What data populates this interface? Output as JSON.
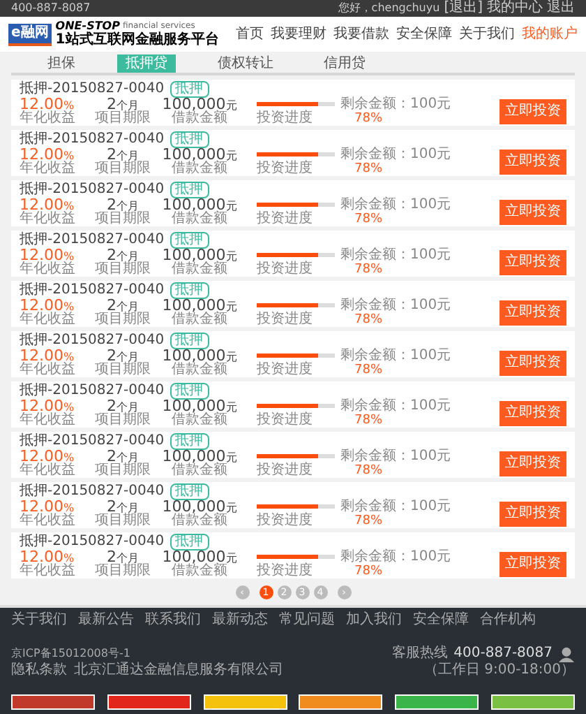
{
  "top_bar": {
    "phone": "400-887-8087",
    "links": [
      "您好，chengchuyu",
      "[退出]",
      "我的中心",
      "退出"
    ]
  },
  "header": {
    "logo": "e融网",
    "slogan_title": "ONE-STOP",
    "slogan_sub": "financial services",
    "slogan_cn": "1站式互联网金融服务平台",
    "nav": [
      {
        "label": "首页",
        "selected": false
      },
      {
        "label": "我要理财",
        "selected": false
      },
      {
        "label": "我要借款",
        "selected": false
      },
      {
        "label": "安全保障",
        "selected": false
      },
      {
        "label": "关于我们",
        "selected": false
      },
      {
        "label": "我的账户",
        "selected": true
      }
    ]
  },
  "tabs": [
    {
      "label": "担保",
      "selected": false
    },
    {
      "label": "抵押贷",
      "selected": true
    },
    {
      "label": "债权转让",
      "selected": false
    },
    {
      "label": "信用贷",
      "selected": false
    }
  ],
  "loans": [
    {
      "title": "抵押-20150827-0040",
      "tag": "抵押",
      "rate": "12.00",
      "rate_unit": "%",
      "rate_label": "年化收益",
      "term": "2",
      "term_unit": "个月",
      "term_label": "项目期限",
      "amount": "100,000",
      "amount_unit": "元",
      "amount_label": "借款金额",
      "progress_label": "投资进度",
      "level": 0.78,
      "percent": "78%",
      "remaining": "剩余金额：100元",
      "button": "立即投资"
    },
    {
      "title": "抵押-20150827-0040",
      "tag": "抵押",
      "rate": "12.00",
      "rate_unit": "%",
      "rate_label": "年化收益",
      "term": "2",
      "term_unit": "个月",
      "term_label": "项目期限",
      "amount": "100,000",
      "amount_unit": "元",
      "amount_label": "借款金额",
      "progress_label": "投资进度",
      "level": 0.78,
      "percent": "78%",
      "remaining": "剩余金额：100元",
      "button": "立即投资"
    },
    {
      "title": "抵押-20150827-0040",
      "tag": "抵押",
      "rate": "12.00",
      "rate_unit": "%",
      "rate_label": "年化收益",
      "term": "2",
      "term_unit": "个月",
      "term_label": "项目期限",
      "amount": "100,000",
      "amount_unit": "元",
      "amount_label": "借款金额",
      "progress_label": "投资进度",
      "level": 0.78,
      "percent": "78%",
      "remaining": "剩余金额：100元",
      "button": "立即投资"
    },
    {
      "title": "抵押-20150827-0040",
      "tag": "抵押",
      "rate": "12.00",
      "rate_unit": "%",
      "rate_label": "年化收益",
      "term": "2",
      "term_unit": "个月",
      "term_label": "项目期限",
      "amount": "100,000",
      "amount_unit": "元",
      "amount_label": "借款金额",
      "progress_label": "投资进度",
      "level": 0.78,
      "percent": "78%",
      "remaining": "剩余金额：100元",
      "button": "立即投资"
    },
    {
      "title": "抵押-20150827-0040",
      "tag": "抵押",
      "rate": "12.00",
      "rate_unit": "%",
      "rate_label": "年化收益",
      "term": "2",
      "term_unit": "个月",
      "term_label": "项目期限",
      "amount": "100,000",
      "amount_unit": "元",
      "amount_label": "借款金额",
      "progress_label": "投资进度",
      "level": 0.78,
      "percent": "78%",
      "remaining": "剩余金额：100元",
      "button": "立即投资"
    },
    {
      "title": "抵押-20150827-0040",
      "tag": "抵押",
      "rate": "12.00",
      "rate_unit": "%",
      "rate_label": "年化收益",
      "term": "2",
      "term_unit": "个月",
      "term_label": "项目期限",
      "amount": "100,000",
      "amount_unit": "元",
      "amount_label": "借款金额",
      "progress_label": "投资进度",
      "level": 0.78,
      "percent": "78%",
      "remaining": "剩余金额：100元",
      "button": "立即投资"
    },
    {
      "title": "抵押-20150827-0040",
      "tag": "抵押",
      "rate": "12.00",
      "rate_unit": "%",
      "rate_label": "年化收益",
      "term": "2",
      "term_unit": "个月",
      "term_label": "项目期限",
      "amount": "100,000",
      "amount_unit": "元",
      "amount_label": "借款金额",
      "progress_label": "投资进度",
      "level": 0.78,
      "percent": "78%",
      "remaining": "剩余金额：100元",
      "button": "立即投资"
    },
    {
      "title": "抵押-20150827-0040",
      "tag": "抵押",
      "rate": "12.00",
      "rate_unit": "%",
      "rate_label": "年化收益",
      "term": "2",
      "term_unit": "个月",
      "term_label": "项目期限",
      "amount": "100,000",
      "amount_unit": "元",
      "amount_label": "借款金额",
      "progress_label": "投资进度",
      "level": 0.78,
      "percent": "78%",
      "remaining": "剩余金额：100元",
      "button": "立即投资"
    },
    {
      "title": "抵押-20150827-0040",
      "tag": "抵押",
      "rate": "12.00",
      "rate_unit": "%",
      "rate_label": "年化收益",
      "term": "2",
      "term_unit": "个月",
      "term_label": "项目期限",
      "amount": "100,000",
      "amount_unit": "元",
      "amount_label": "借款金额",
      "progress_label": "投资进度",
      "level": 0.78,
      "percent": "78%",
      "remaining": "剩余金额：100元",
      "button": "立即投资"
    },
    {
      "title": "抵押-20150827-0040",
      "tag": "抵押",
      "rate": "12.00",
      "rate_unit": "%",
      "rate_label": "年化收益",
      "term": "2",
      "term_unit": "个月",
      "term_label": "项目期限",
      "amount": "100,000",
      "amount_unit": "元",
      "amount_label": "借款金额",
      "progress_label": "投资进度",
      "level": 0.78,
      "percent": "78%",
      "remaining": "剩余金额：100元",
      "button": "立即投资"
    }
  ],
  "pagination": [
    {
      "label": "‹",
      "kind": "arrow",
      "selected": false
    },
    {
      "label": "1",
      "kind": "page",
      "selected": true
    },
    {
      "label": "2",
      "kind": "page",
      "selected": false
    },
    {
      "label": "3",
      "kind": "page",
      "selected": false
    },
    {
      "label": "4",
      "kind": "page",
      "selected": false
    },
    {
      "label": "›",
      "kind": "arrow",
      "selected": false
    }
  ],
  "footer": {
    "links": [
      "关于我们",
      "最新公告",
      "联系我们",
      "最新动态",
      "常见问题",
      "加入我们",
      "安全保障",
      "合作机构"
    ],
    "icp": "京ICP备15012008号-1",
    "icp_links": [
      "隐私条款",
      "北京汇通达金融信息服务有限公司"
    ],
    "hotline_label": "客服热线",
    "hotline": "400-887-8087",
    "hours": "（工作日 9:00-18:00）",
    "badges": [
      {
        "color": "#c0392b"
      },
      {
        "color": "#e2261c"
      },
      {
        "color": "#f4c20d"
      },
      {
        "color": "#f08c1e"
      },
      {
        "color": "#3bb54a"
      },
      {
        "color": "#7ac143"
      }
    ]
  }
}
